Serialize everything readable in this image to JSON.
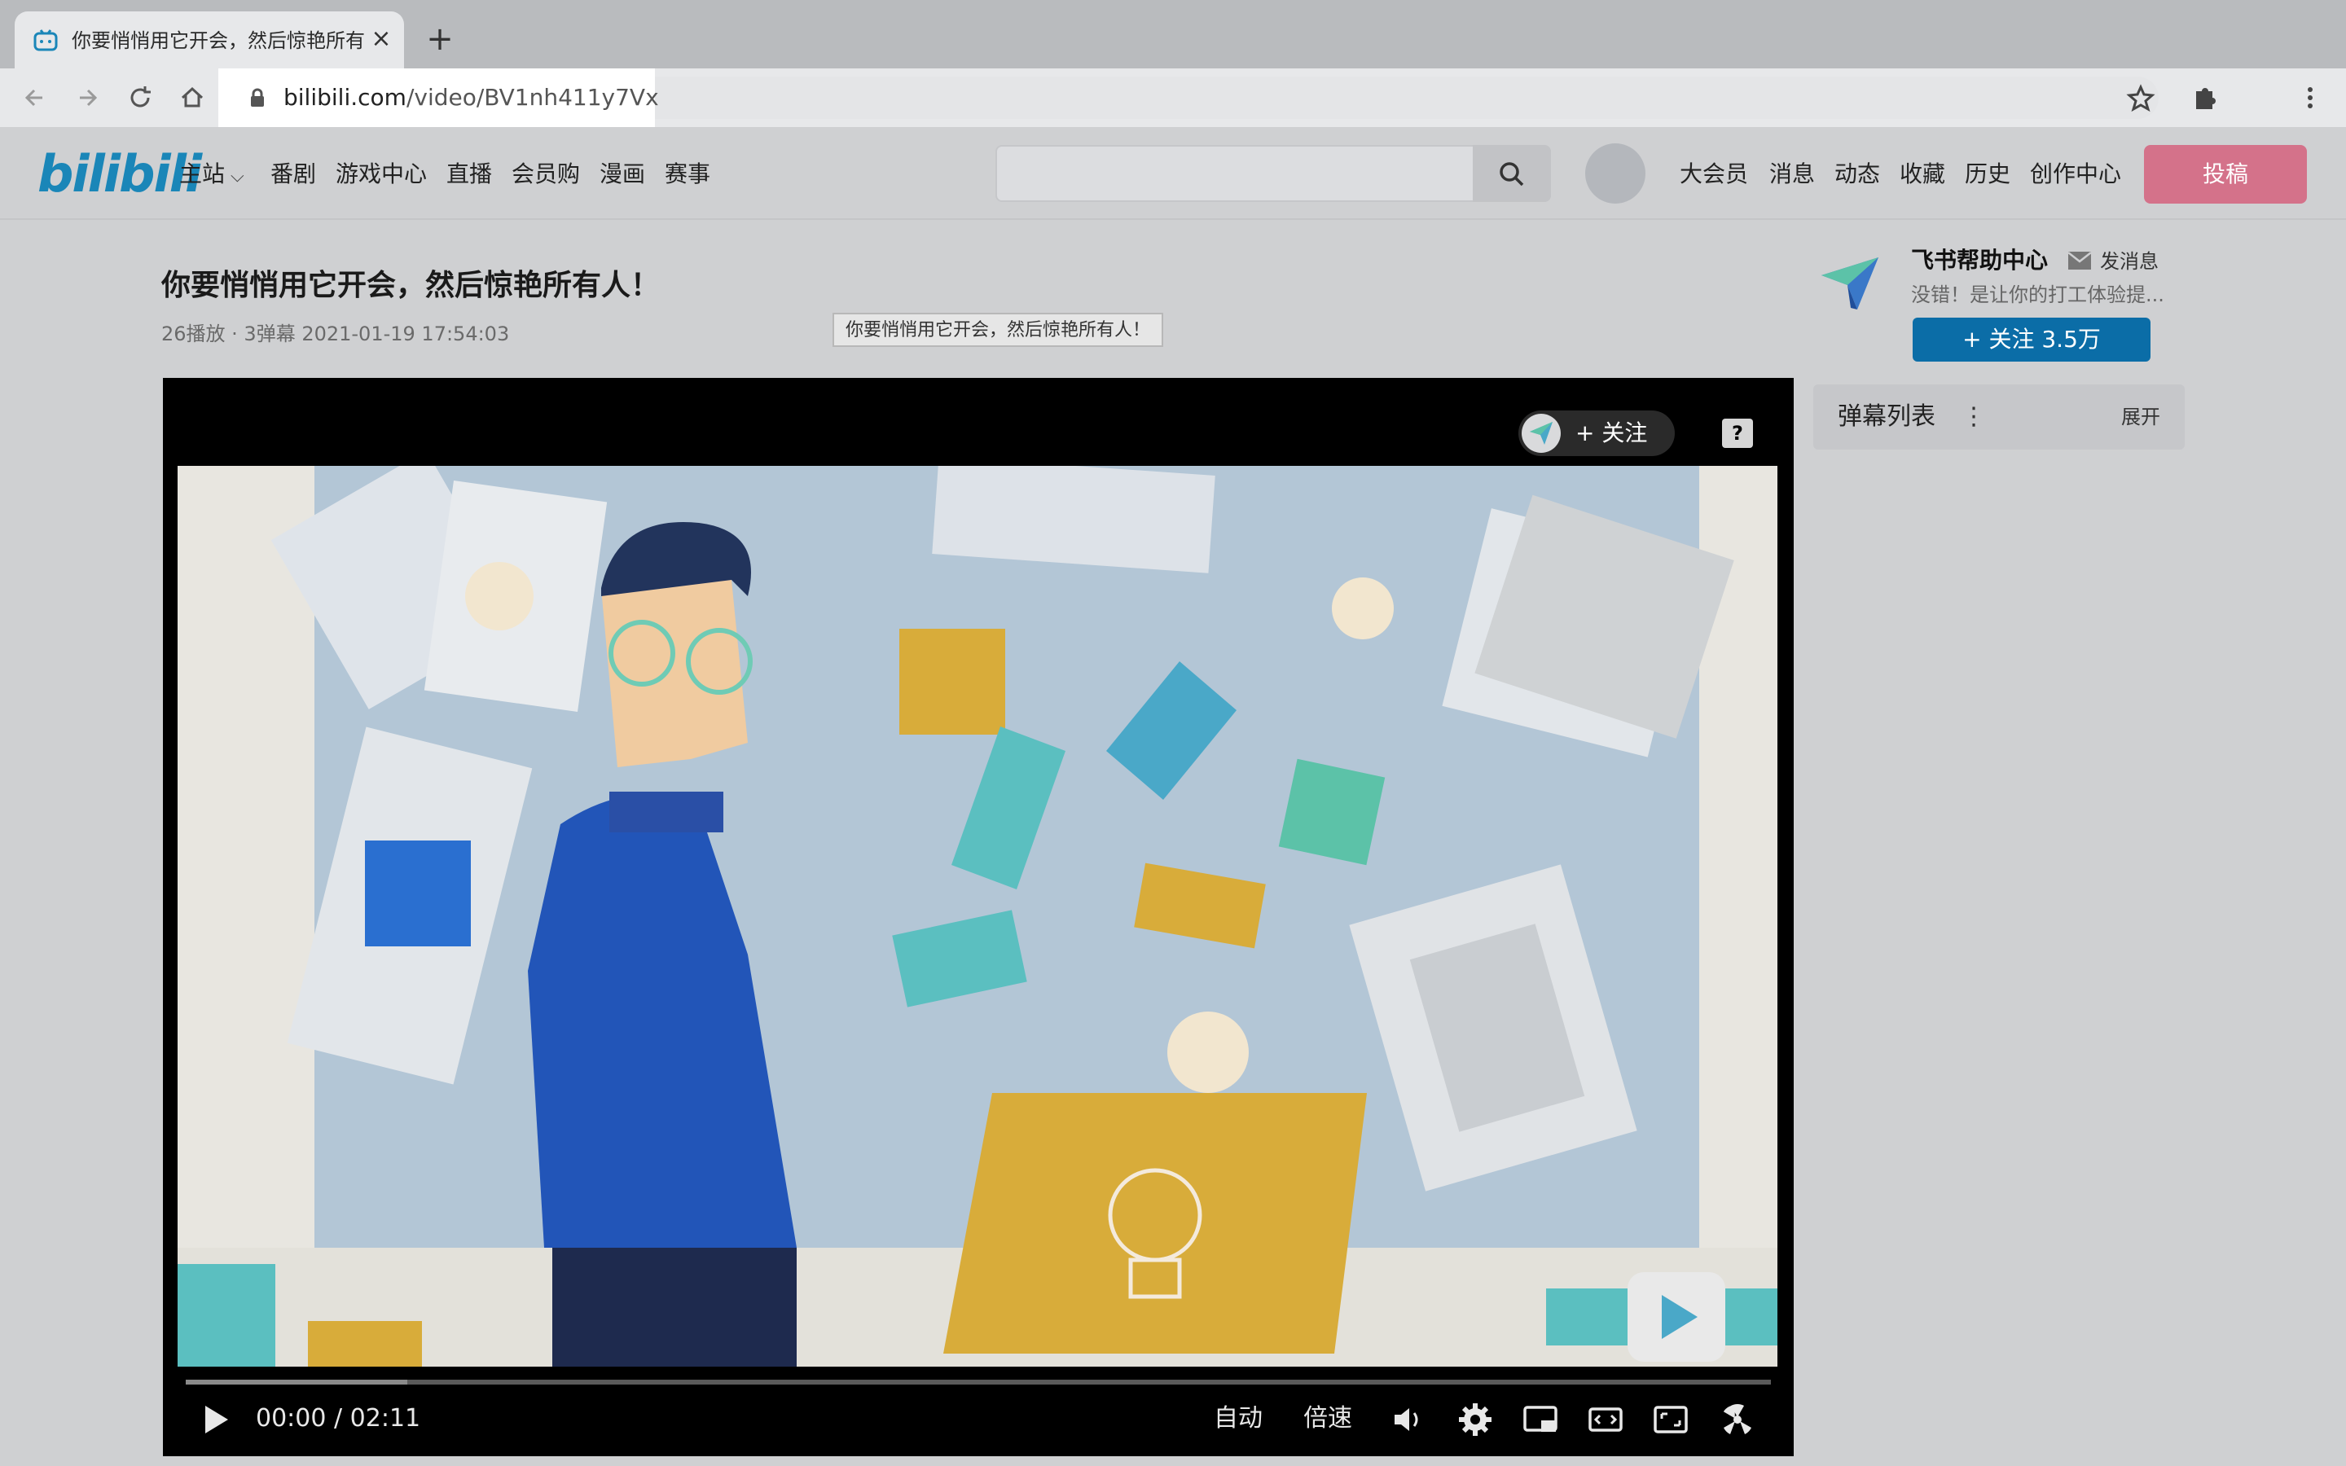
{
  "browser": {
    "tab_title": "你要悄悄用它开会，然后惊艳所有人！",
    "tab_close": "×",
    "new_tab": "+",
    "url_domain": "bilibili.com",
    "url_path": "/video/BV1nh411y7Vx"
  },
  "site": {
    "logo": "bilibili",
    "nav": [
      "主站",
      "番剧",
      "游戏中心",
      "直播",
      "会员购",
      "漫画",
      "赛事"
    ],
    "right_nav": [
      "大会员",
      "消息",
      "动态",
      "收藏",
      "历史",
      "创作中心"
    ],
    "upload_label": "投稿",
    "search_placeholder": ""
  },
  "video": {
    "title": "你要悄悄用它开会，然后惊艳所有人！",
    "meta": "26播放 · 3弹幕    2021-01-19 17:54:03",
    "tooltip": "你要悄悄用它开会，然后惊艳所有人！",
    "follow_overlay": "+ 关注",
    "help_icon_label": "?",
    "time_current": "00:00",
    "time_sep": "/",
    "time_total": "02:11",
    "progress": 0.14,
    "quality": "自动",
    "speed": "倍速"
  },
  "uploader": {
    "name": "飞书帮助中心",
    "message_label": "发消息",
    "description": "没错！是让你的打工体验提...",
    "follow_label": "+  关注 3.5万"
  },
  "danmaku": {
    "title": "弹幕列表",
    "menu": "⋮",
    "expand": "展开"
  },
  "colors": {
    "brand_blue": "#1a86b8",
    "upload_pink": "#d4728a",
    "follow_blue": "#0b6da7"
  }
}
